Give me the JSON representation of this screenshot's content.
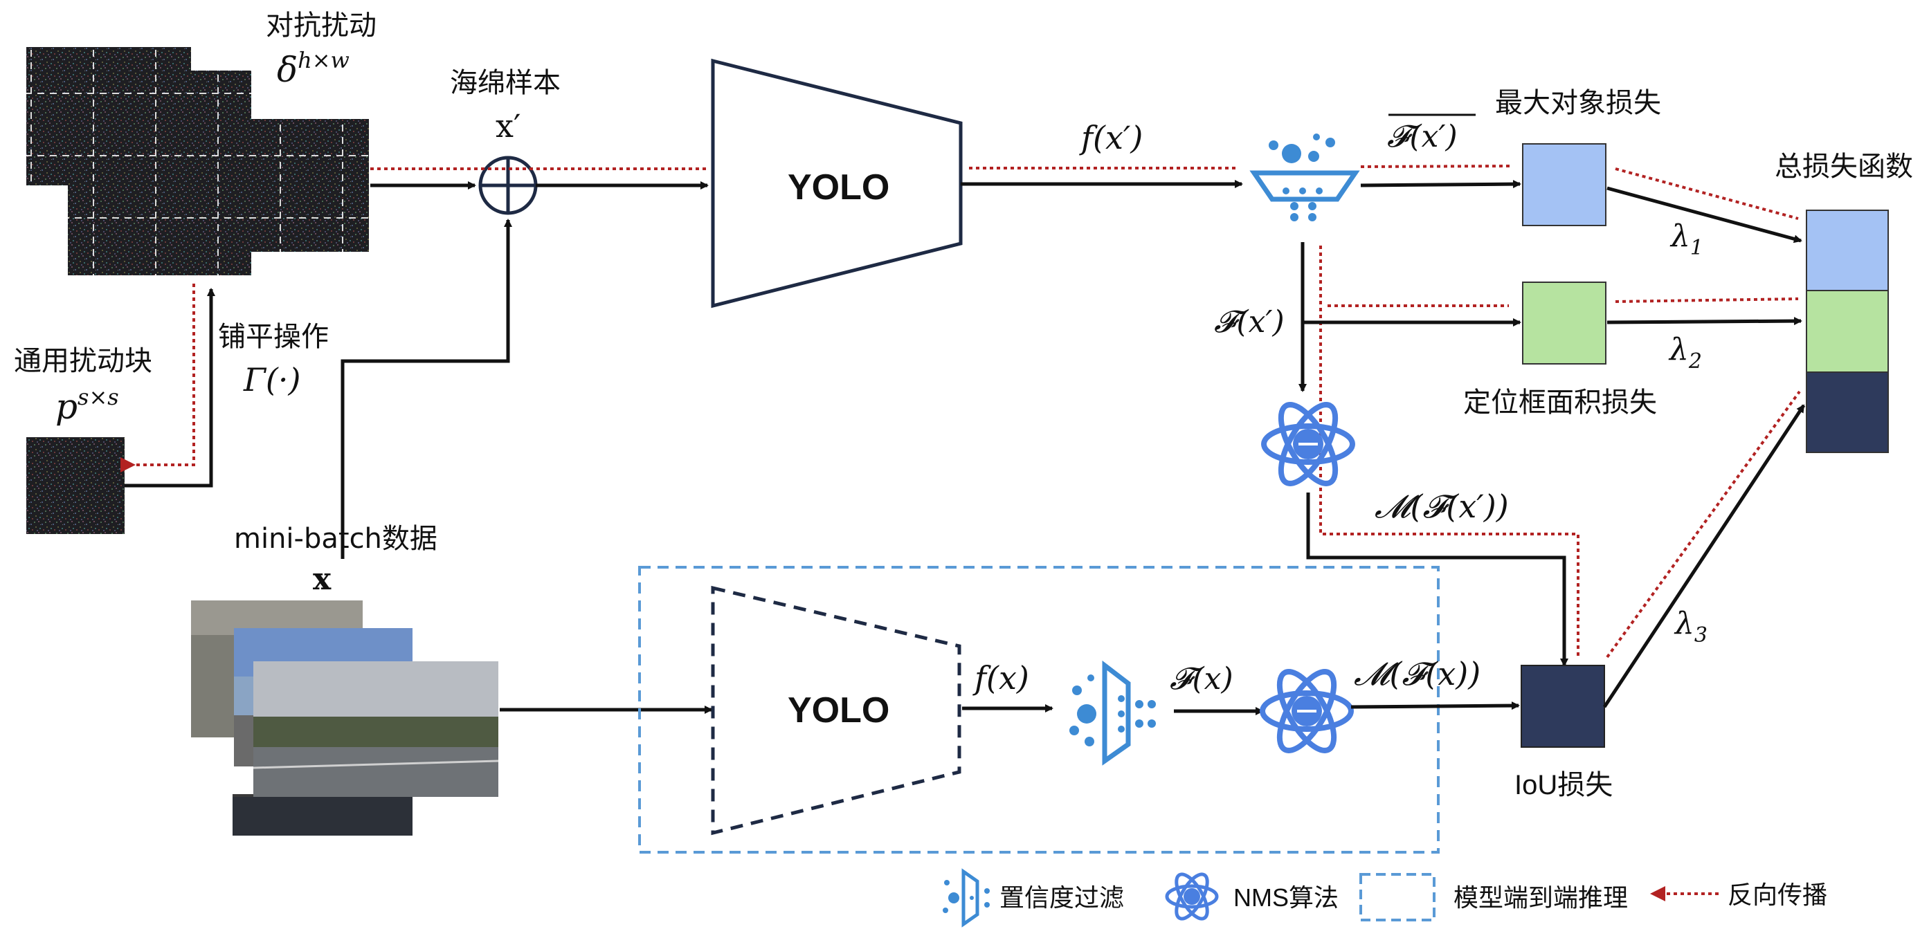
{
  "labels": {
    "perturbation_title": "对抗扰动",
    "perturbation_symbol": "δ",
    "perturbation_sup": "h×w",
    "sponge_title": "海绵样本",
    "sponge_symbol": "x′",
    "tiling_title": "铺平操作",
    "tiling_symbol": "Γ(·)",
    "patch_title": "通用扰动块",
    "patch_symbol": "p",
    "patch_sup": "s×s",
    "minibatch_title": "mini-batch数据",
    "minibatch_symbol": "x",
    "yolo_top": "YOLO",
    "yolo_bottom": "YOLO",
    "f_xprime": "f(x′)",
    "F_xprime_bar": "𝓕(x′)",
    "F_xprime": "𝓕(x′)",
    "M_F_xprime": "𝓜(𝓕(x′))",
    "f_x": "f(x)",
    "F_x": "𝓕(x)",
    "M_F_x": "𝓜(𝓕(x))",
    "max_object_loss": "最大对象损失",
    "bbox_area_loss": "定位框面积损失",
    "iou_loss": "IoU损失",
    "total_loss": "总损失函数",
    "lambda1": "λ",
    "lambda1_sub": "1",
    "lambda2": "λ",
    "lambda2_sub": "2",
    "lambda3": "λ",
    "lambda3_sub": "3"
  },
  "legend": {
    "filter_label": "置信度过滤",
    "nms_label": "NMS算法",
    "e2e_label": "模型端到端推理",
    "backprop_label": "反向传播"
  },
  "colors": {
    "max_object_loss": "#a4c2f4",
    "bbox_area_loss": "#b6e3a0",
    "iou_loss": "#2e3a5c",
    "icon_blue": "#3d8bd4",
    "nms_blue": "#4a7fe0",
    "backprop_red": "#b22222",
    "dashed_box": "#5a9ad6"
  }
}
